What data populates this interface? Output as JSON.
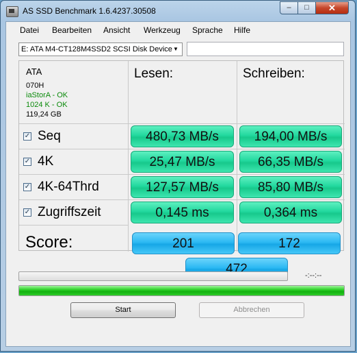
{
  "window": {
    "title": "AS SSD Benchmark 1.6.4237.30508",
    "min_glyph": "–",
    "max_glyph": "□",
    "close_glyph": "✕"
  },
  "menu": [
    "Datei",
    "Bearbeiten",
    "Ansicht",
    "Werkzeug",
    "Sprache",
    "Hilfe"
  ],
  "drive": {
    "selected": "E: ATA M4-CT128M4SSD2 SCSI Disk Device",
    "arrow": "▼",
    "text_value": ""
  },
  "info": {
    "vendor": "ATA",
    "firmware": "070H",
    "driver_status": "iaStorA - OK",
    "alignment_status": "1024 K - OK",
    "capacity": "119,24 GB"
  },
  "columns": {
    "read": "Lesen:",
    "write": "Schreiben:"
  },
  "rows": [
    {
      "label": "Seq",
      "checked": true,
      "read": "480,73 MB/s",
      "write": "194,00 MB/s"
    },
    {
      "label": "4K",
      "checked": true,
      "read": "25,47 MB/s",
      "write": "66,35 MB/s"
    },
    {
      "label": "4K-64Thrd",
      "checked": true,
      "read": "127,57 MB/s",
      "write": "85,80 MB/s"
    },
    {
      "label": "Zugriffszeit",
      "checked": true,
      "read": "0,145 ms",
      "write": "0,364 ms"
    }
  ],
  "checkmark": "✓",
  "score": {
    "label": "Score:",
    "read": "201",
    "write": "172",
    "total": "472"
  },
  "progress": {
    "test_progress": 0,
    "elapsed_text": "-:--:--",
    "overall_progress": 1.0,
    "color": "#13b10f"
  },
  "buttons": {
    "start": "Start",
    "cancel": "Abbrechen"
  },
  "colors": {
    "result_green": "#22d89e",
    "score_blue": "#2cb9f3",
    "ok_text": "#0b8a0b"
  }
}
